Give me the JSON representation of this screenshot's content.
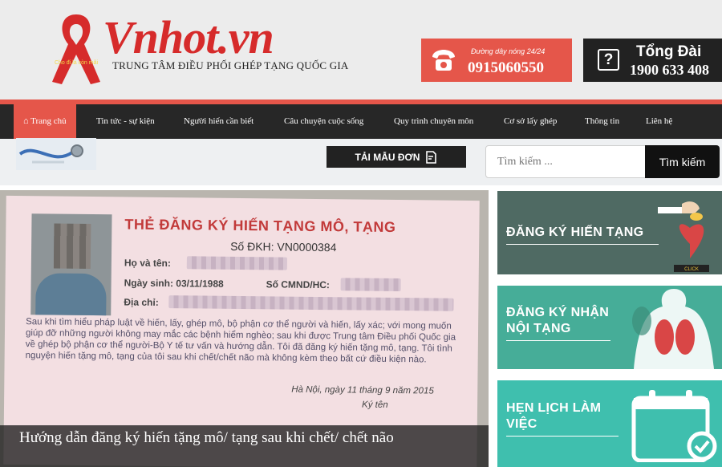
{
  "brand": {
    "logo_text": "Vnhot.vn",
    "ribbon_text": "Cho đi là còn mãi",
    "subtitle": "TRUNG TÂM ĐIỀU PHỐI GHÉP TẠNG QUỐC GIA"
  },
  "hotline": {
    "label": "Đường dây nóng 24/24",
    "number": "0915060550"
  },
  "switchboard": {
    "title": "Tổng Đài",
    "number": "1900 633 408"
  },
  "nav": {
    "items": [
      {
        "label": "Trang chủ",
        "icon": "home-icon",
        "active": true
      },
      {
        "label": "Tin tức - sự kiện"
      },
      {
        "label": "Người hiến cần biết"
      },
      {
        "label": "Câu chuyện cuộc sống"
      },
      {
        "label": "Quy trình chuyên môn"
      },
      {
        "label": "Cơ sở lấy ghép"
      },
      {
        "label": "Thông tin"
      },
      {
        "label": "Liên hệ"
      }
    ]
  },
  "toolbar": {
    "download_label": "TẢI MẪU ĐƠN",
    "search_placeholder": "Tìm kiếm ...",
    "search_button": "Tìm kiếm"
  },
  "feature": {
    "card": {
      "title": "THẺ ĐĂNG KÝ HIẾN TẠNG MÔ, TẠNG",
      "reg_no": "Số ĐKH: VN0000384",
      "name_label": "Họ và tên:",
      "dob_label": "Ngày sinh: 03/11/1988",
      "id_label": "Số CMND/HC:",
      "address_label": "Địa chỉ:",
      "body": "Sau khi tìm hiểu pháp luật về hiến, lấy, ghép mô, bộ phận cơ thể người và hiến, lấy xác; với mong muốn giúp đỡ những người không may mắc các bệnh hiểm nghèo; sau khi được Trung tâm Điều phối Quốc gia về ghép bộ phận cơ thể người-Bộ Y tế tư vấn và hướng dẫn. Tôi đã đăng ký hiến tặng mô, tạng. Tôi tình nguyện hiến tặng mô, tạng của tôi sau khi chết/chết não mà không kèm theo bất cứ điều kiện nào.",
      "place_date": "Hà Nội, ngày 11 tháng 9 năm 2015",
      "sign_label": "Ký tên"
    },
    "caption": "Hướng dẫn đăng ký hiến tặng mô/ tạng sau khi chết/ chết não"
  },
  "banners": [
    {
      "line1": "ĐĂNG KÝ HIẾN TẠNG",
      "line2": "",
      "badge": "CLICK",
      "color": "#4f6a63"
    },
    {
      "line1": "ĐĂNG KÝ NHẬN",
      "line2": "NỘI TẠNG",
      "color": "#46ad98"
    },
    {
      "line1": "HẸN LỊCH LÀM",
      "line2": "VIỆC",
      "color": "#3fbfae"
    }
  ]
}
